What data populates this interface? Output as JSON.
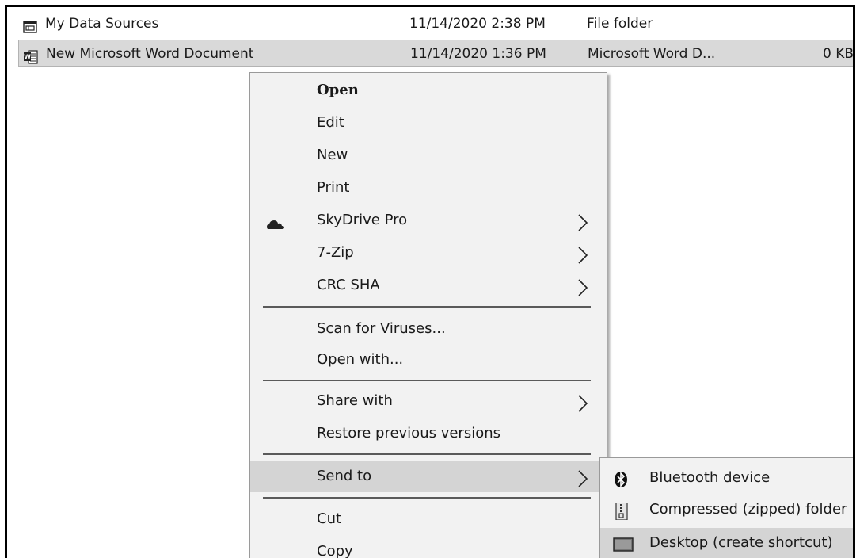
{
  "files": [
    {
      "name": "My Data Sources",
      "date": "11/14/2020 2:38 PM",
      "type": "File folder",
      "size": "",
      "icon": "data-sources-folder-icon",
      "selected": false
    },
    {
      "name": "New Microsoft Word Document",
      "date": "11/14/2020 1:36 PM",
      "type": "Microsoft Word D...",
      "size": "0 KB",
      "icon": "word-document-icon",
      "selected": true
    }
  ],
  "context_menu": {
    "items": [
      {
        "label": "Open",
        "bold": true
      },
      {
        "label": "Edit"
      },
      {
        "label": "New"
      },
      {
        "label": "Print"
      },
      {
        "label": "SkyDrive Pro",
        "icon": "skydrive-cloud-icon",
        "submenu": true
      },
      {
        "label": "7-Zip",
        "submenu": true
      },
      {
        "label": "CRC SHA",
        "submenu": true
      },
      {
        "label": "Scan for Viruses..."
      },
      {
        "label": "Open with..."
      },
      {
        "label": "Share with",
        "submenu": true
      },
      {
        "label": "Restore previous versions"
      },
      {
        "label": "Send to",
        "submenu": true,
        "highlighted": true
      },
      {
        "label": "Cut"
      },
      {
        "label": "Copy"
      }
    ]
  },
  "send_to_submenu": {
    "items": [
      {
        "label": "Bluetooth device",
        "icon": "bluetooth-icon"
      },
      {
        "label": "Compressed (zipped) folder",
        "icon": "zip-folder-icon"
      },
      {
        "label": "Desktop (create shortcut)",
        "icon": "desktop-icon",
        "highlighted": true
      }
    ]
  },
  "colors": {
    "menu_background": "#f2f2f2",
    "highlight": "#d4d4d4",
    "selected_row": "#d9d9d9"
  }
}
